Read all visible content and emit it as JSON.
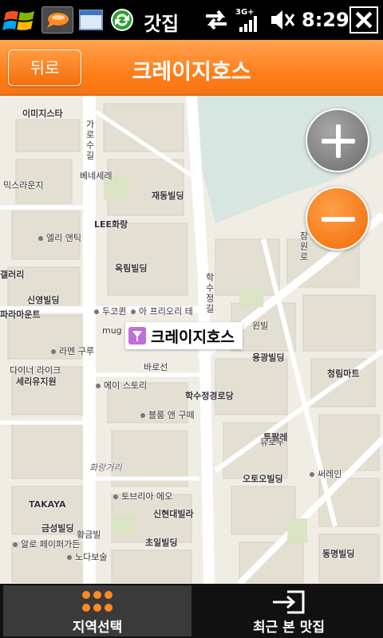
{
  "status_bar": {
    "app_title": "갓집",
    "network": "3G+",
    "time": "8:29",
    "icons": [
      "windows-start-icon",
      "app-bubble-icon",
      "window-icon",
      "sync-icon",
      "connection-arrows-icon",
      "signal-icon",
      "volume-icon",
      "close-icon"
    ]
  },
  "header": {
    "back_label": "뒤로",
    "title": "크레이지호스"
  },
  "map": {
    "marker_label": "크레이지호스",
    "labels": {
      "l1": "이미지스타",
      "l2": "가로수길",
      "l3": "베네세레",
      "l4": "믹스라운지",
      "l5": "재동빌딩",
      "l6": "LEE화랑",
      "l7": "엘리 앤틱",
      "l8": "옥림빌딩",
      "l9": "갤러리",
      "l10": "신영빌딩",
      "l11": "두코퀸",
      "l12": "아 프리오리 테",
      "l13": "파라마운트",
      "l14": "라멘 구루",
      "l15": "다이너 라이크",
      "l16": "세리유지원",
      "l17": "에이 스토리",
      "l18": "블룸 앤 구떼",
      "l19": "학수정경로당",
      "l20": "용광빌딩",
      "l21": "청림마트",
      "l22": "오토오빌딩",
      "l23": "써레인",
      "l24": "화랑거리",
      "l25": "TAKAYA",
      "l26": "금성빌딩",
      "l27": "알로 페이퍼가든",
      "l28": "노다보술",
      "l29": "신현대빌라",
      "l30": "초일빌딩",
      "l31": "동명빌딩",
      "l32": "학수정길",
      "l33": "잠원로",
      "l34": "윈빌",
      "l35": "투팔레",
      "l36": "뮤로우",
      "l37": "토브리아 에오",
      "l38": "바로선",
      "l39": "황금빌",
      "l40": "mug"
    }
  },
  "tabs": [
    {
      "label": "지역선택",
      "icon": "region-dots-icon"
    },
    {
      "label": "최근 본 맛집",
      "icon": "recent-arrow-icon"
    }
  ],
  "colors": {
    "header_orange": "#ff8a24",
    "zoom_out_orange": "#f16b06",
    "marker_purple": "#c06fd6"
  }
}
